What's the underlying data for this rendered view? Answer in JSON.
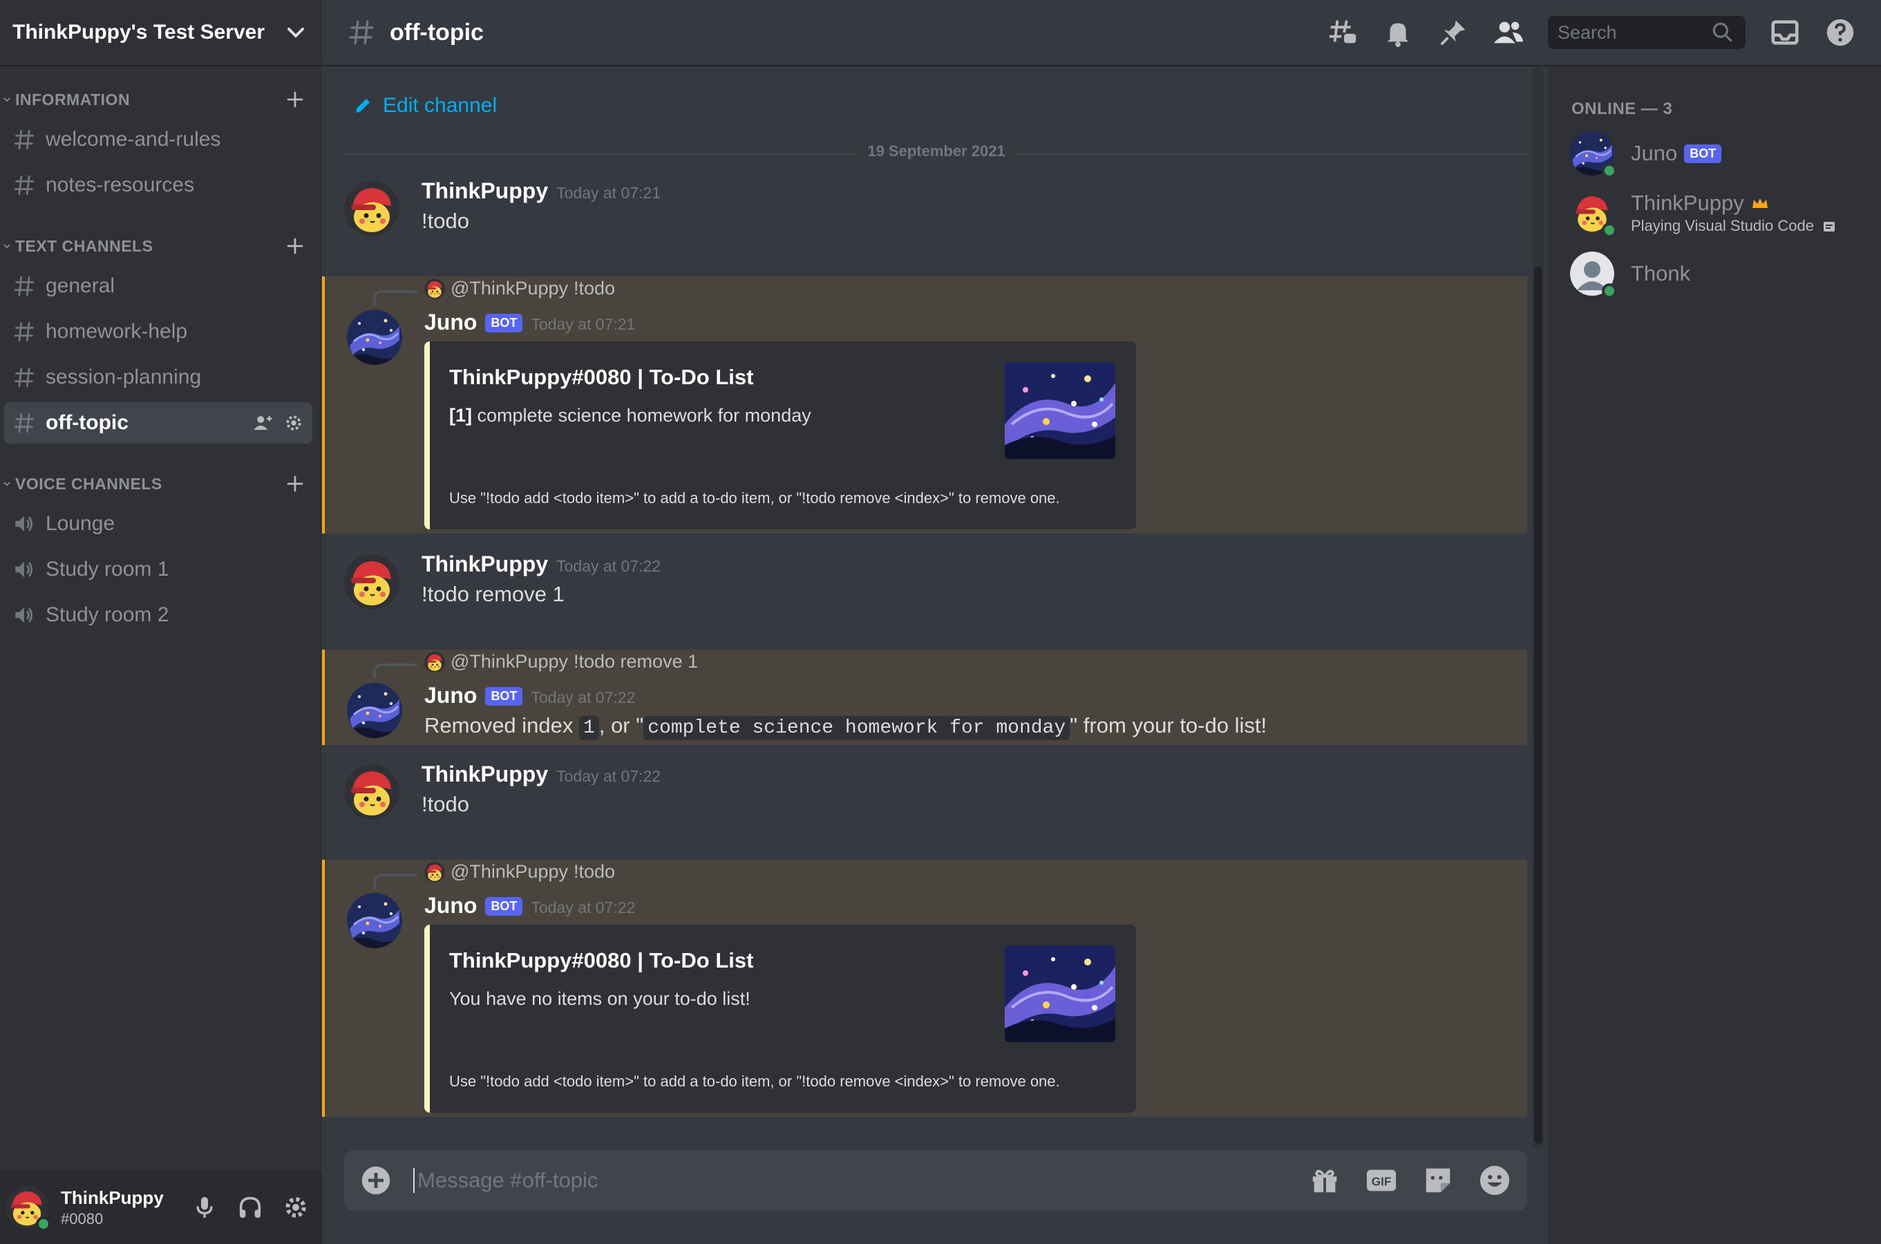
{
  "server": {
    "name": "ThinkPuppy's Test Server"
  },
  "categories": {
    "information": "INFORMATION",
    "text": "TEXT CHANNELS",
    "voice": "VOICE CHANNELS"
  },
  "channels": {
    "information": [
      "welcome-and-rules",
      "notes-resources"
    ],
    "text": [
      "general",
      "homework-help",
      "session-planning",
      "off-topic"
    ],
    "voice": [
      "Lounge",
      "Study room 1",
      "Study room 2"
    ]
  },
  "header": {
    "channel": "off-topic",
    "search_placeholder": "Search"
  },
  "chat": {
    "edit_channel": "Edit channel",
    "date": "19 September 2021",
    "messages": [
      {
        "author": "ThinkPuppy",
        "time": "Today at 07:21",
        "text": "!todo"
      },
      {
        "reply_to": "@ThinkPuppy",
        "reply_text": "!todo",
        "author": "Juno",
        "bot": "BOT",
        "time": "Today at 07:21",
        "embed": {
          "title": "ThinkPuppy#0080 | To-Do List",
          "index": "[1]",
          "desc": "complete science homework for monday",
          "footer": "Use \"!todo add <todo item>\" to add a to-do item, or \"!todo remove <index>\" to remove one."
        }
      },
      {
        "author": "ThinkPuppy",
        "time": "Today at 07:22",
        "text": "!todo remove 1"
      },
      {
        "reply_to": "@ThinkPuppy",
        "reply_text": "!todo remove 1",
        "author": "Juno",
        "bot": "BOT",
        "time": "Today at 07:22",
        "text_prefix": "Removed index",
        "code_index": "1",
        "text_mid": ", or \"",
        "code_item": "complete science homework for monday",
        "text_suffix": "\" from your to-do list!"
      },
      {
        "author": "ThinkPuppy",
        "time": "Today at 07:22",
        "text": "!todo"
      },
      {
        "reply_to": "@ThinkPuppy",
        "reply_text": "!todo",
        "author": "Juno",
        "bot": "BOT",
        "time": "Today at 07:22",
        "embed": {
          "title": "ThinkPuppy#0080 | To-Do List",
          "desc": "You have no items on your to-do list!",
          "footer": "Use \"!todo add <todo item>\" to add a to-do item, or \"!todo remove <index>\" to remove one."
        }
      }
    ]
  },
  "composer": {
    "placeholder": "Message #off-topic"
  },
  "members": {
    "label": "ONLINE — 3",
    "list": [
      {
        "name": "Juno",
        "bot": "BOT"
      },
      {
        "name": "ThinkPuppy",
        "status": "Playing Visual Studio Code"
      },
      {
        "name": "Thonk"
      }
    ]
  },
  "user": {
    "name": "ThinkPuppy",
    "tag": "#0080"
  },
  "colors": {
    "accent": "#5865f2",
    "mention_bar": "#faa81a",
    "online": "#3ba55d",
    "link": "#00aff4"
  }
}
